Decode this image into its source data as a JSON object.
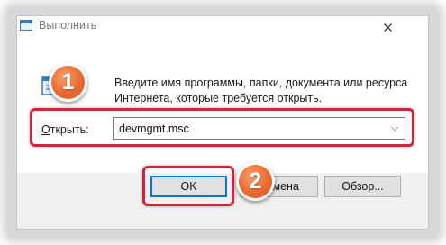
{
  "window": {
    "title": "Выполнить",
    "close_glyph": "✕"
  },
  "instructions": "Введите имя программы, папки, документа или ресурса Интернета, которые требуется открыть.",
  "open_field": {
    "label_accel": "О",
    "label_rest": "ткрыть:",
    "value": "devmgmt.msc",
    "dropdown_glyph": "⌵"
  },
  "buttons": {
    "ok": "OK",
    "cancel": "Отмена",
    "browse": "Обзор..."
  },
  "annotations": {
    "step1": "1",
    "step2": "2",
    "highlight_color": "#d2233c",
    "badge_color": "#ea6a31"
  },
  "colors": {
    "accent": "#0078d7",
    "button_strip": "#f0f0f0"
  }
}
